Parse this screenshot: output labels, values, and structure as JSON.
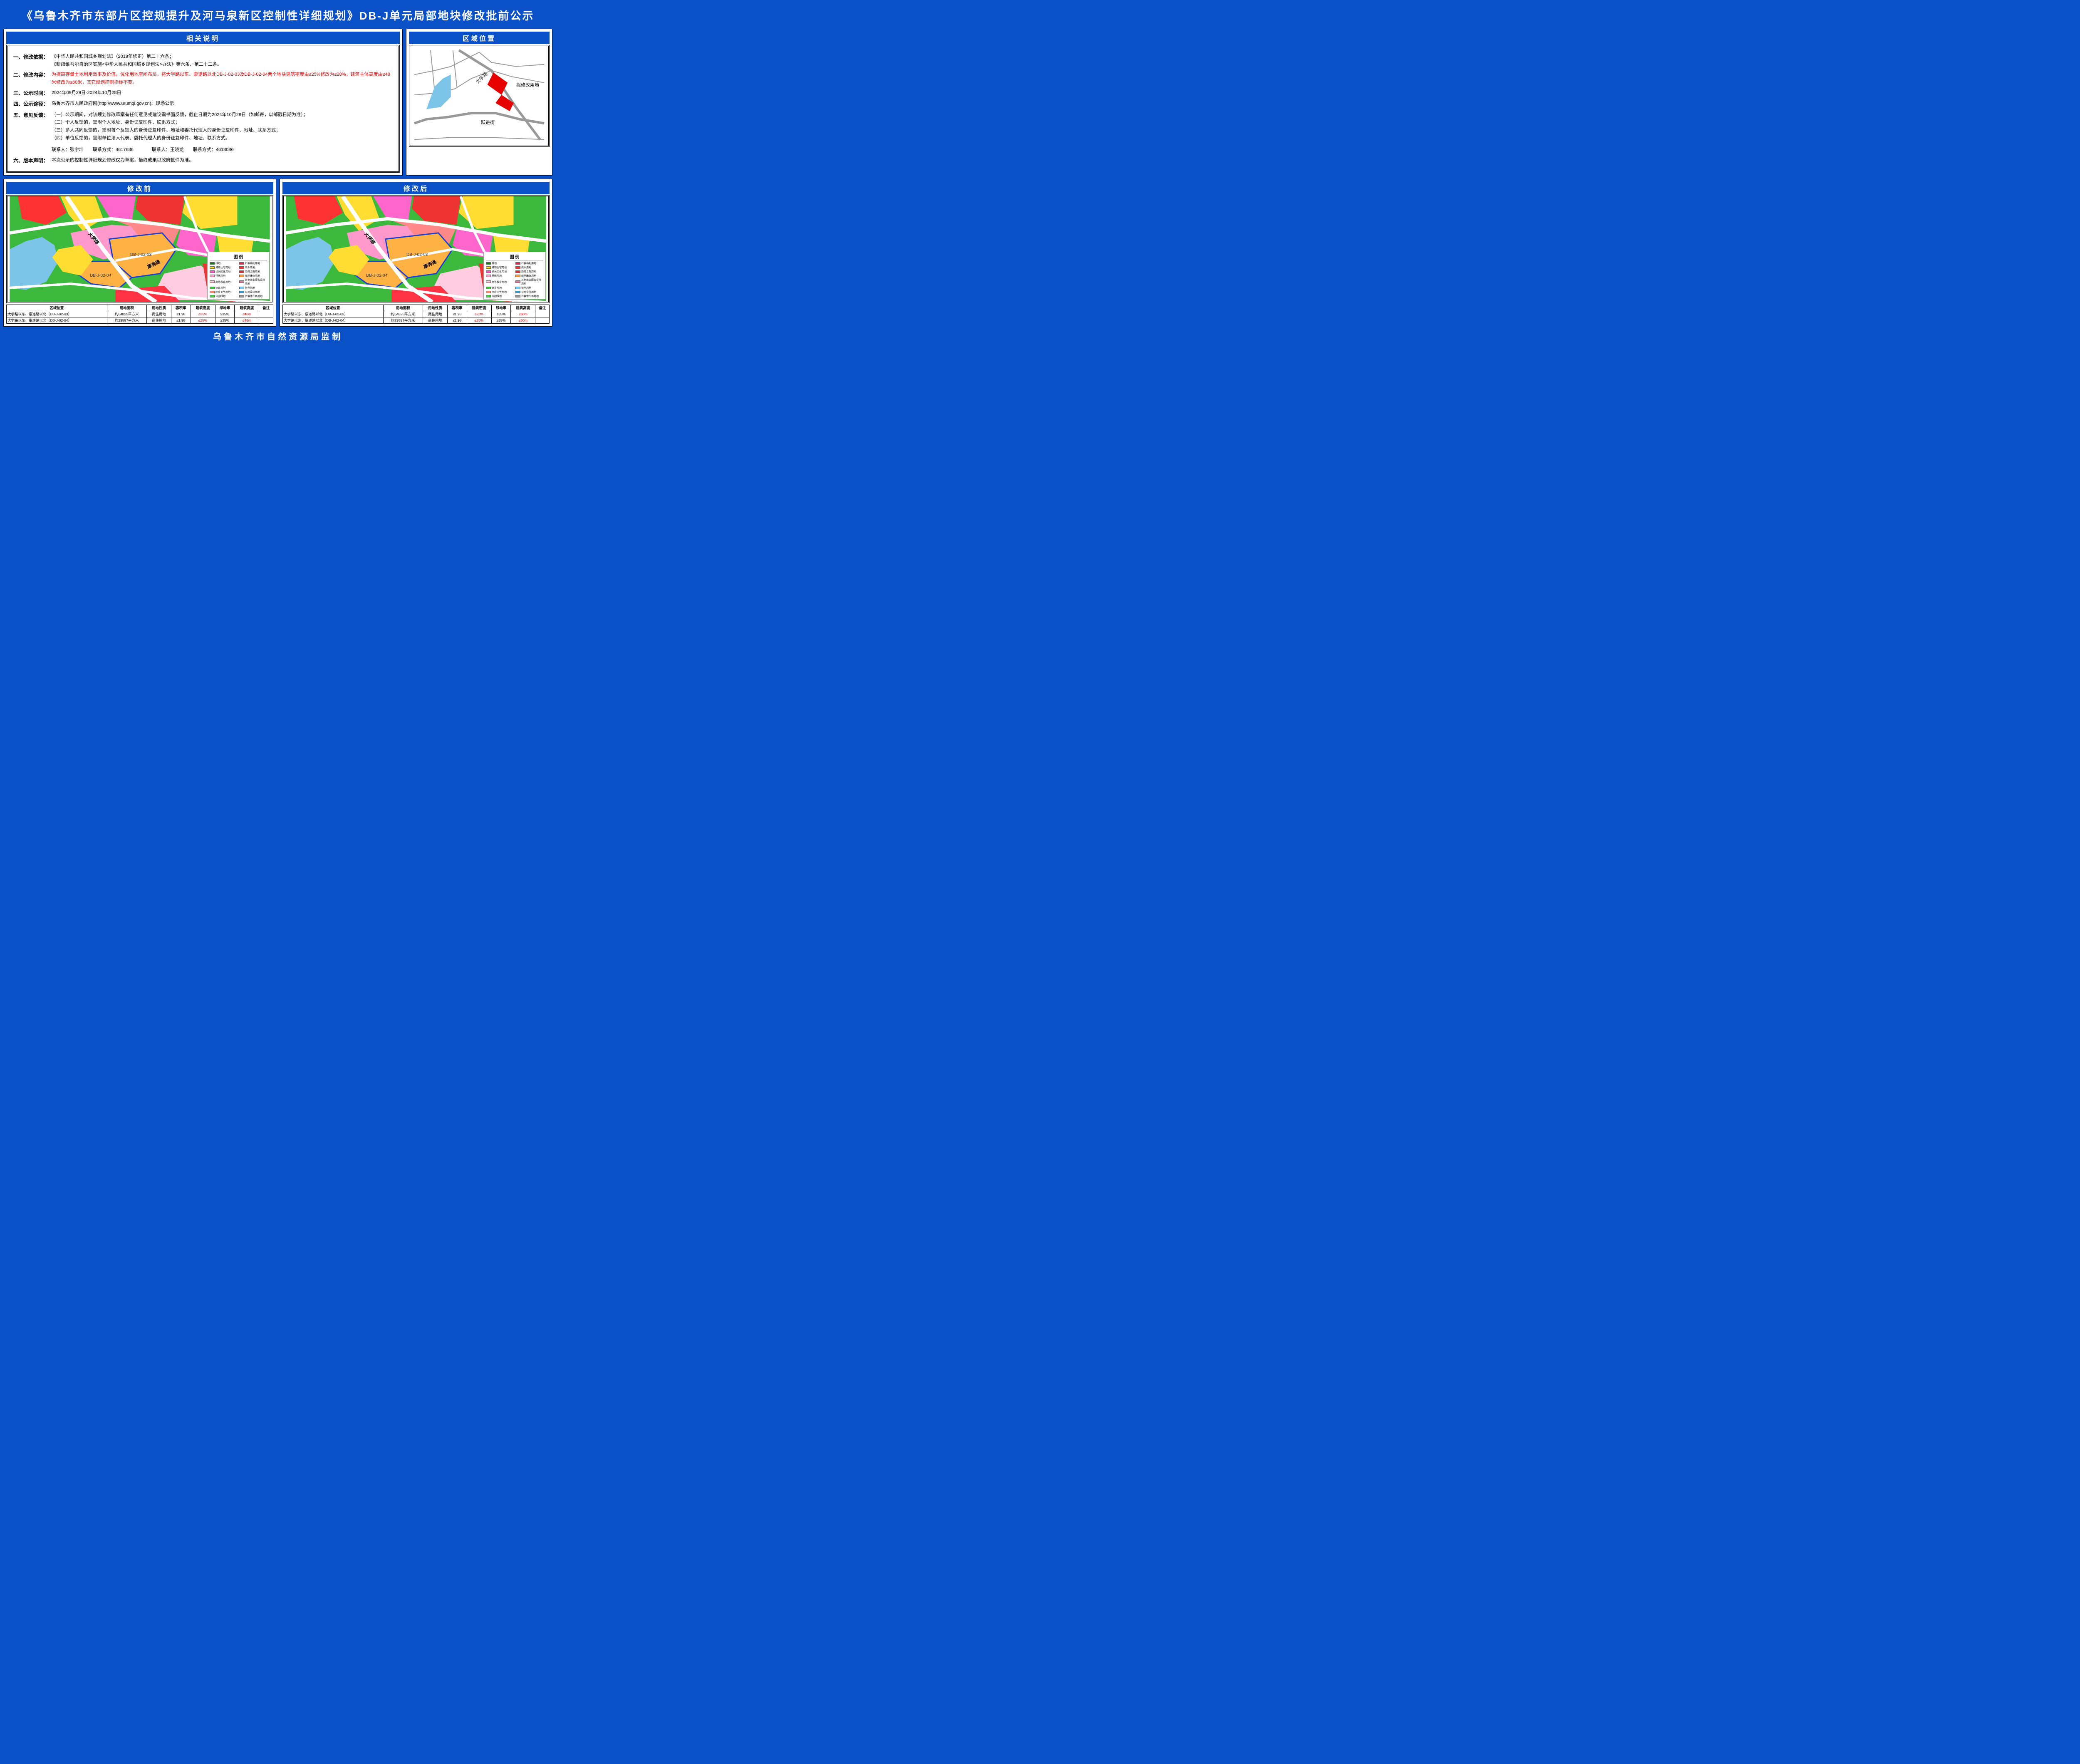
{
  "title": "《乌鲁木齐市东部片区控规提升及河马泉新区控制性详细规划》DB-J单元局部地块修改批前公示",
  "footer": "乌鲁木齐市自然资源局监制",
  "sections": {
    "explain_header": "相关说明",
    "location_header": "区域位置",
    "before_header": "修改前",
    "after_header": "修改后"
  },
  "explain": {
    "items": [
      {
        "label": "一、修改依据：",
        "text": "《中华人民共和国城乡规划法》（2019年修正）第二十六条；\n《新疆维吾尔自治区实施<中华人民共和国城乡规划法>办法》第六条、第二十二条。"
      },
      {
        "label": "二、修改内容：",
        "text_red": "为提高存量土地利用效率及价值，优化用地空间布局，将大学路以东、康遂路以北DB-J-02-03及DB-J-02-04两个地块建筑密度由≤25%修改为≤28%，建筑主体高度由≤48米修改为≤60米，其它规划控制指标不变。"
      },
      {
        "label": "三、公示时间：",
        "text": "2024年09月29日-2024年10月28日"
      },
      {
        "label": "四、公示途径：",
        "text": "乌鲁木齐市人民政府网(http://www.urumqi.gov.cn)、现场公示"
      },
      {
        "label": "五、意见反馈：",
        "text": "（一）公示期间，对该规划修改草案有任何意见或建议需书面反馈，截止日期为2024年10月28日（如邮寄，以邮戳日期为准）；\n（二）个人反馈的，需附个人地址、身份证复印件、联系方式；\n（三）多人共同反馈的，需附每个反馈人的身份证复印件、地址和委托代理人的身份证复印件、地址、联系方式；\n（四）单位反馈的，需附单位法人代表、委托代理人的身份证复印件、地址、联系方式。"
      },
      {
        "label": "六、版本声明：",
        "text": "本次公示的控制性详细规划修改仅为草案，最终成果以政府批件为准。"
      }
    ],
    "contacts": "联系人：张宇坤　　联系方式：4617686　　　　联系人：王晓龙　　联系方式：4618086"
  },
  "location_labels": {
    "road1": "大学路",
    "road2": "跃进街",
    "site": "拟修改用地"
  },
  "map_labels": {
    "parcel1": "DB-J-02-03",
    "parcel2": "DB-J-02-04",
    "road_a": "大学路",
    "road_b": "康秀路"
  },
  "legend": {
    "title": "图 例",
    "items": [
      {
        "name": "林地",
        "color": "#1a7a1a"
      },
      {
        "name": "社会福利用地",
        "color": "#e03050"
      },
      {
        "name": "城镇住宅用地",
        "color": "#ffdd33"
      },
      {
        "name": "商业用地",
        "color": "#ff3333"
      },
      {
        "name": "机关团体用地",
        "color": "#ff66cc"
      },
      {
        "name": "商务金融用地",
        "color": "#cc3333"
      },
      {
        "name": "科研用地",
        "color": "#ff99cc"
      },
      {
        "name": "娱乐康体用地",
        "color": "#ff9933"
      },
      {
        "name": "高等教育用地",
        "color": "#ffcce0"
      },
      {
        "name": "其他商业服务设施用地",
        "color": "#dd88aa"
      },
      {
        "name": "体育用地",
        "color": "#33cc33"
      },
      {
        "name": "供电用地",
        "color": "#66ccff"
      },
      {
        "name": "医疗卫生用地",
        "color": "#ff8866"
      },
      {
        "name": "公用设施用地",
        "color": "#3399cc"
      },
      {
        "name": "公园绿地",
        "color": "#44dd44"
      },
      {
        "name": "社会停车场用地",
        "color": "#999999"
      }
    ]
  },
  "table_before": {
    "headers": [
      "区域位置",
      "用地面积",
      "用地性质",
      "容积率",
      "建筑密度",
      "绿地率",
      "建筑高度",
      "备注"
    ],
    "rows": [
      [
        "大学路以东、康遂路以北（DB-J-02-03）",
        "约64825平方米",
        "商住用地",
        "≤1.98",
        "≤25%",
        "≥35%",
        "≤48m",
        ""
      ],
      [
        "大学路以东、康遂路以北（DB-J-02-04）",
        "约29597平方米",
        "商住用地",
        "≤1.98",
        "≤25%",
        "≥35%",
        "≤48m",
        ""
      ]
    ]
  },
  "table_after": {
    "headers": [
      "区域位置",
      "用地面积",
      "用地性质",
      "容积率",
      "建筑密度",
      "绿地率",
      "建筑高度",
      "备注"
    ],
    "rows": [
      [
        "大学路以东、康遂路以北（DB-J-02-03）",
        "约64825平方米",
        "商住用地",
        "≤1.98",
        "≤28%",
        "≥35%",
        "≤60m",
        ""
      ],
      [
        "大学路以东、康遂路以北（DB-J-02-04）",
        "约29597平方米",
        "商住用地",
        "≤1.98",
        "≤28%",
        "≥35%",
        "≤60m",
        ""
      ]
    ]
  },
  "changed_cols": [
    4,
    6
  ]
}
